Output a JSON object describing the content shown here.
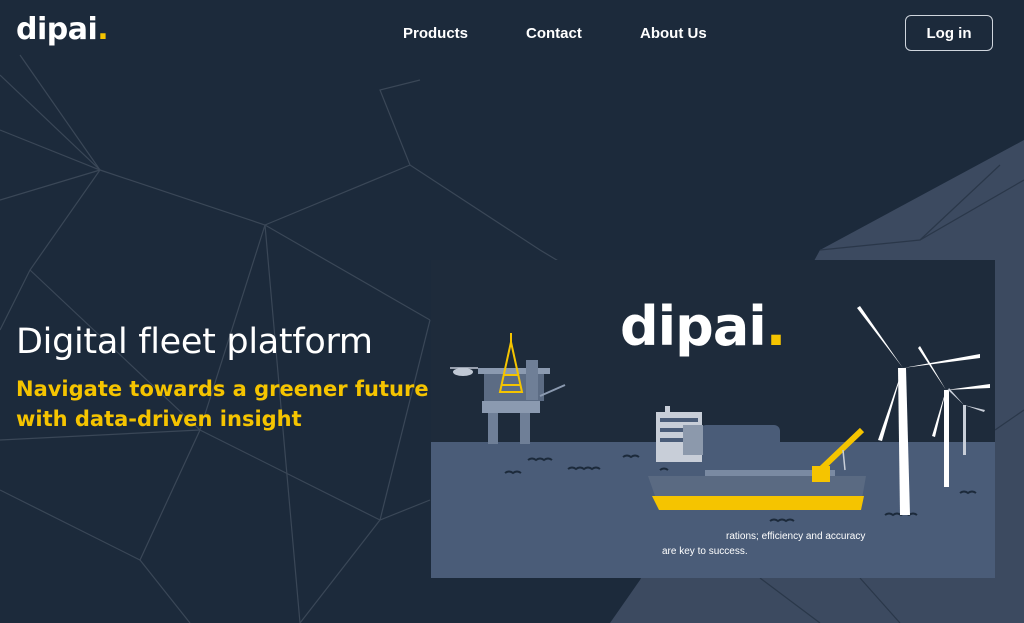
{
  "header": {
    "logo_text": "dipai",
    "logo_dot": ".",
    "nav": [
      "Products",
      "Contact",
      "About Us"
    ],
    "login_label": "Log in"
  },
  "hero": {
    "title": "Digital fleet platform",
    "subtitle_lines": [
      "Navigate towards a greener future",
      "with data-driven insight"
    ]
  },
  "illustration": {
    "logo_text": "dipai",
    "logo_dot": ".",
    "caption_lines": [
      "rations; efficiency and accuracy",
      "are key to success."
    ]
  },
  "colors": {
    "background": "#1c2a3b",
    "accent": "#f5c400",
    "illustration_sky": "#1e2b3b",
    "illustration_sea": "#4a5c78"
  }
}
